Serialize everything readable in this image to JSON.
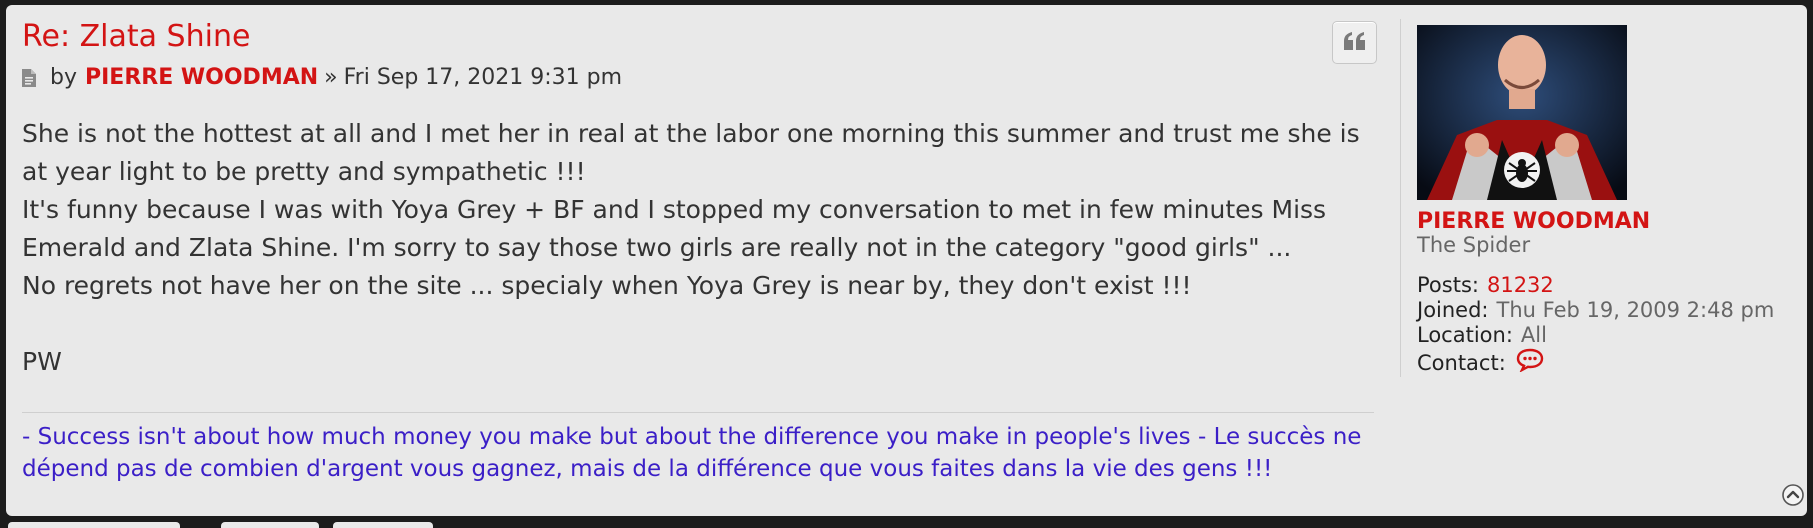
{
  "post": {
    "title": "Re: Zlata Shine",
    "meta": {
      "by": "by",
      "author": "PIERRE WOODMAN",
      "separator": "»",
      "date": "Fri Sep 17, 2021 9:31 pm"
    },
    "content": [
      "She is not the hottest at all and I met her in real at the labor one morning this summer and trust me she is at year light to be pretty and sympathetic !!!",
      "It's funny because I was with Yoya Grey + BF and I stopped my conversation to met in few minutes Miss Emerald and Zlata Shine. I'm sorry to say those two girls are really not in the category \"good girls\" ...",
      "No regrets not have her on the site ... specialy when Yoya Grey is near by, they don't exist !!!",
      "PW"
    ],
    "signature": "- Success isn't about how much money you make but about the difference you make in people's lives - Le succès ne dépend pas de combien d'argent vous gagnez, mais de la différence que vous faites dans la vie des gens !!!"
  },
  "profile": {
    "username": "PIERRE WOODMAN",
    "rank": "The Spider",
    "posts_label": "Posts:",
    "posts_value": "81232",
    "joined_label": "Joined:",
    "joined_value": "Thu Feb 19, 2009 2:48 pm",
    "location_label": "Location:",
    "location_value": "All",
    "contact_label": "Contact:"
  },
  "icons": {
    "post": "file-icon",
    "quote": "quote-icon",
    "contact": "speech-bubble-icon",
    "top": "arrow-up-circle-icon"
  },
  "colors": {
    "accent_red": "#d31414",
    "signature_blue": "#3b1fc7",
    "panel_bg": "#e9e9e9"
  }
}
